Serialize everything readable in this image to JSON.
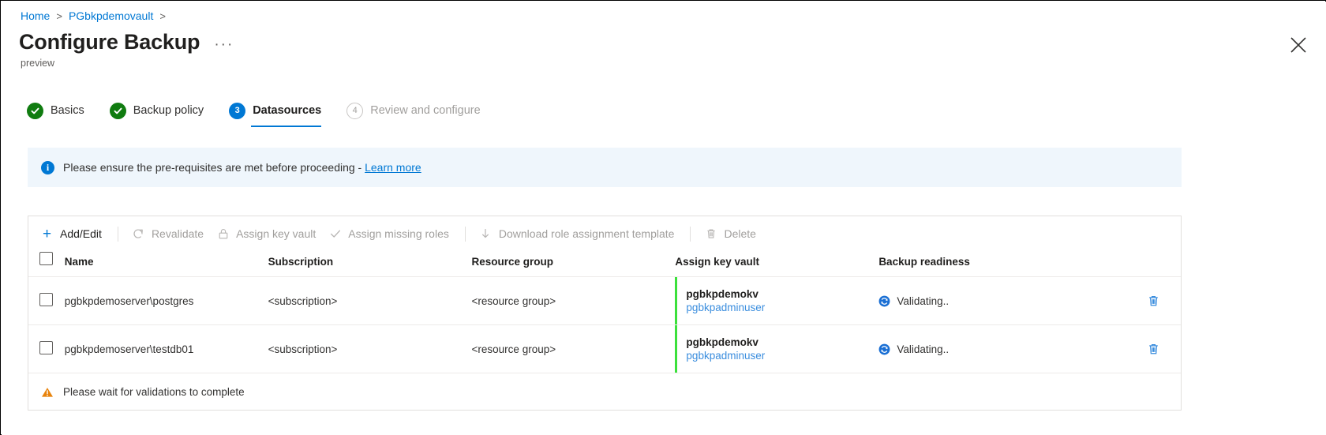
{
  "breadcrumb": {
    "items": [
      {
        "label": "Home"
      },
      {
        "label": "PGbkpdemovault"
      }
    ],
    "separator": ">"
  },
  "header": {
    "title": "Configure Backup",
    "more_label": "···",
    "subtitle": "preview",
    "close_icon": "close-icon"
  },
  "wizard": {
    "steps": [
      {
        "badge": "✓",
        "label": "Basics",
        "state": "done"
      },
      {
        "badge": "✓",
        "label": "Backup policy",
        "state": "done"
      },
      {
        "badge": "3",
        "label": "Datasources",
        "state": "current"
      },
      {
        "badge": "4",
        "label": "Review and configure",
        "state": "todo"
      }
    ]
  },
  "info_banner": {
    "icon": "info-icon",
    "text": "Please ensure the pre-requisites are met before proceeding - ",
    "link_label": "Learn more",
    "background": "#eff6fc",
    "accent": "#0078d4"
  },
  "toolbar": {
    "commands": [
      {
        "icon": "plus-icon",
        "label": "Add/Edit",
        "enabled": true
      },
      {
        "icon": "refresh-icon",
        "label": "Revalidate",
        "enabled": false
      },
      {
        "icon": "lock-icon",
        "label": "Assign key vault",
        "enabled": false
      },
      {
        "icon": "checkmark-icon",
        "label": "Assign missing roles",
        "enabled": false
      },
      {
        "icon": "download-icon",
        "label": "Download role assignment template",
        "enabled": false
      },
      {
        "icon": "trash-icon",
        "label": "Delete",
        "enabled": false
      }
    ]
  },
  "table": {
    "columns": [
      "Name",
      "Subscription",
      "Resource group",
      "Assign key vault",
      "Backup readiness"
    ],
    "rows": [
      {
        "name": "pgbkpdemoserver\\postgres",
        "subscription": "<subscription>",
        "resource_group": "<resource group>",
        "key_vault": "pgbkpdemokv",
        "key_vault_user": "pgbkpadminuser",
        "readiness": "Validating..",
        "readiness_icon": "sync-icon",
        "delete_icon": "trash-icon"
      },
      {
        "name": "pgbkpdemoserver\\testdb01",
        "subscription": "<subscription>",
        "resource_group": "<resource group>",
        "key_vault": "pgbkpdemokv",
        "key_vault_user": "pgbkpadminuser",
        "readiness": "Validating..",
        "readiness_icon": "sync-icon",
        "delete_icon": "trash-icon"
      }
    ]
  },
  "footer": {
    "icon": "warning-icon",
    "text": "Please wait for validations to complete",
    "color": "#e8830c"
  }
}
